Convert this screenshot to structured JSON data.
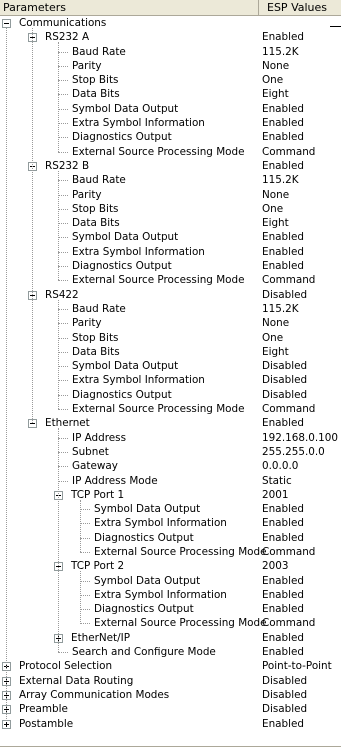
{
  "header": {
    "param_col": "Parameters",
    "value_col": "ESP Values"
  },
  "tree": [
    {
      "label": "Communications",
      "value": "",
      "level": 0,
      "exp": "minus"
    },
    {
      "label": "RS232 A",
      "value": "Enabled",
      "level": 1,
      "exp": "minus"
    },
    {
      "label": "Baud Rate",
      "value": "115.2K",
      "level": 2
    },
    {
      "label": "Parity",
      "value": "None",
      "level": 2
    },
    {
      "label": "Stop Bits",
      "value": "One",
      "level": 2
    },
    {
      "label": "Data Bits",
      "value": "Eight",
      "level": 2
    },
    {
      "label": "Symbol Data Output",
      "value": "Enabled",
      "level": 2
    },
    {
      "label": "Extra Symbol Information",
      "value": "Enabled",
      "level": 2
    },
    {
      "label": "Diagnostics Output",
      "value": "Enabled",
      "level": 2
    },
    {
      "label": "External Source Processing Mode",
      "value": "Command",
      "level": 2
    },
    {
      "label": "RS232 B",
      "value": "Enabled",
      "level": 1,
      "exp": "minus"
    },
    {
      "label": "Baud Rate",
      "value": "115.2K",
      "level": 2
    },
    {
      "label": "Parity",
      "value": "None",
      "level": 2
    },
    {
      "label": "Stop Bits",
      "value": "One",
      "level": 2
    },
    {
      "label": "Data Bits",
      "value": "Eight",
      "level": 2
    },
    {
      "label": "Symbol Data Output",
      "value": "Enabled",
      "level": 2
    },
    {
      "label": "Extra Symbol Information",
      "value": "Enabled",
      "level": 2
    },
    {
      "label": "Diagnostics Output",
      "value": "Enabled",
      "level": 2
    },
    {
      "label": "External Source Processing Mode",
      "value": "Command",
      "level": 2
    },
    {
      "label": "RS422",
      "value": "Disabled",
      "level": 1,
      "exp": "minus"
    },
    {
      "label": "Baud Rate",
      "value": "115.2K",
      "level": 2
    },
    {
      "label": "Parity",
      "value": "None",
      "level": 2
    },
    {
      "label": "Stop Bits",
      "value": "One",
      "level": 2
    },
    {
      "label": "Data Bits",
      "value": "Eight",
      "level": 2
    },
    {
      "label": "Symbol Data Output",
      "value": "Disabled",
      "level": 2
    },
    {
      "label": "Extra Symbol Information",
      "value": "Disabled",
      "level": 2
    },
    {
      "label": "Diagnostics Output",
      "value": "Disabled",
      "level": 2
    },
    {
      "label": "External Source Processing Mode",
      "value": "Command",
      "level": 2
    },
    {
      "label": "Ethernet",
      "value": "Enabled",
      "level": 1,
      "exp": "minus"
    },
    {
      "label": "IP Address",
      "value": "192.168.0.100",
      "level": 2
    },
    {
      "label": "Subnet",
      "value": "255.255.0.0",
      "level": 2
    },
    {
      "label": "Gateway",
      "value": "0.0.0.0",
      "level": 2
    },
    {
      "label": "IP Address Mode",
      "value": "Static",
      "level": 2
    },
    {
      "label": "TCP Port 1",
      "value": "2001",
      "level": 2,
      "exp": "minus"
    },
    {
      "label": "Symbol Data Output",
      "value": "Enabled",
      "level": 3
    },
    {
      "label": "Extra Symbol Information",
      "value": "Enabled",
      "level": 3
    },
    {
      "label": "Diagnostics Output",
      "value": "Enabled",
      "level": 3
    },
    {
      "label": "External Source Processing Mode",
      "value": "Command",
      "level": 3
    },
    {
      "label": "TCP Port 2",
      "value": "2003",
      "level": 2,
      "exp": "minus"
    },
    {
      "label": "Symbol Data Output",
      "value": "Enabled",
      "level": 3
    },
    {
      "label": "Extra Symbol Information",
      "value": "Enabled",
      "level": 3
    },
    {
      "label": "Diagnostics Output",
      "value": "Enabled",
      "level": 3
    },
    {
      "label": "External Source Processing Mode",
      "value": "Command",
      "level": 3
    },
    {
      "label": "EtherNet/IP",
      "value": "Enabled",
      "level": 2,
      "exp": "plus"
    },
    {
      "label": "Search and Configure Mode",
      "value": "Enabled",
      "level": 2
    },
    {
      "label": "Protocol Selection",
      "value": "Point-to-Point",
      "level": 0,
      "exp": "plus"
    },
    {
      "label": "External Data Routing",
      "value": "Disabled",
      "level": 0,
      "exp": "plus"
    },
    {
      "label": "Array Communication Modes",
      "value": "Disabled",
      "level": 0,
      "exp": "plus"
    },
    {
      "label": "Preamble",
      "value": "Disabled",
      "level": 0,
      "exp": "plus"
    },
    {
      "label": "Postamble",
      "value": "Enabled",
      "level": 0,
      "exp": "plus"
    }
  ]
}
